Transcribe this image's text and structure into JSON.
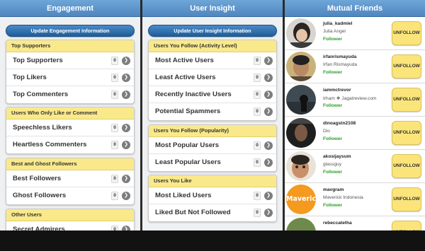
{
  "engagement": {
    "title": "Engagement",
    "update_label": "Update Engagement Information",
    "sections": [
      {
        "header": "Top Supporters",
        "rows": [
          {
            "label": "Top Supporters",
            "count": "0"
          },
          {
            "label": "Top Likers",
            "count": "0"
          },
          {
            "label": "Top Commenters",
            "count": "0"
          }
        ]
      },
      {
        "header": "Users Who Only Like or Comment",
        "rows": [
          {
            "label": "Speechless Likers",
            "count": "0"
          },
          {
            "label": "Heartless Commenters",
            "count": "0"
          }
        ]
      },
      {
        "header": "Best and Ghost Followers",
        "rows": [
          {
            "label": "Best Followers",
            "count": "0"
          },
          {
            "label": "Ghost Followers",
            "count": "0"
          }
        ]
      },
      {
        "header": "Other Users",
        "rows": [
          {
            "label": "Secret Admirers",
            "count": "0"
          }
        ]
      }
    ]
  },
  "insight": {
    "title": "User Insight",
    "update_label": "Update User Insight Information",
    "sections": [
      {
        "header": "Users You Follow (Activity Level)",
        "rows": [
          {
            "label": "Most Active Users",
            "count": "0"
          },
          {
            "label": "Least Active Users",
            "count": "0"
          },
          {
            "label": "Recently Inactive Users",
            "count": "0"
          },
          {
            "label": "Potential Spammers",
            "count": "0"
          }
        ]
      },
      {
        "header": "Users You Follow (Popularity)",
        "rows": [
          {
            "label": "Most Popular Users",
            "count": "0"
          },
          {
            "label": "Least Popular Users",
            "count": "0"
          }
        ]
      },
      {
        "header": "Users You Like",
        "rows": [
          {
            "label": "Most Liked Users",
            "count": "0"
          },
          {
            "label": "Liked But Not Followed",
            "count": "0"
          }
        ]
      }
    ]
  },
  "mutual": {
    "title": "Mutual Friends",
    "unfollow_label": "UNFOLLOW",
    "friends": [
      {
        "username": "julia_kadmiel",
        "name": "Julia Angel",
        "status": "Follower"
      },
      {
        "username": "irfanrismayuda",
        "name": "Irfan Rismayuda",
        "status": "Follower"
      },
      {
        "username": "iammctrevor",
        "name": "Irham ❖ Jagatreview.com",
        "status": "Follower"
      },
      {
        "username": "dinoagstn2108",
        "name": "Dio",
        "status": "Follower"
      },
      {
        "username": "akosijaysum",
        "name": "glassguy",
        "status": "Follower"
      },
      {
        "username": "mavgram",
        "name": "Maverick Indonesia",
        "status": "Follower",
        "avatar_text": "Maverick"
      },
      {
        "username": "rebeccatetha",
        "name": "",
        "status": ""
      }
    ]
  }
}
